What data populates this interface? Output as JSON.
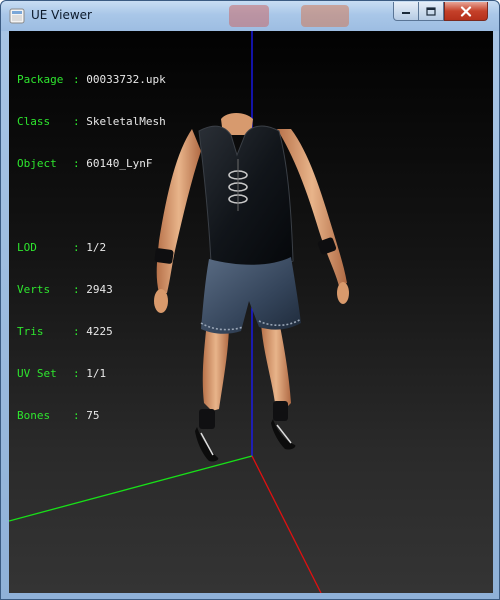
{
  "window": {
    "title": "UE Viewer",
    "app_icon": "ue-viewer-icon",
    "buttons": {
      "minimize_icon": "minimize-icon",
      "maximize_icon": "maximize-icon",
      "close_icon": "close-icon"
    }
  },
  "info": {
    "package": {
      "label": "Package",
      "value": "00033732.upk"
    },
    "class": {
      "label": "Class",
      "value": "SkeletalMesh"
    },
    "object": {
      "label": "Object",
      "value": "60140_LynF"
    },
    "lod": {
      "label": "LOD",
      "value": "1/2"
    },
    "verts": {
      "label": "Verts",
      "value": "2943"
    },
    "tris": {
      "label": "Tris",
      "value": "4225"
    },
    "uvset": {
      "label": "UV Set",
      "value": "1/1"
    },
    "bones": {
      "label": "Bones",
      "value": "75"
    },
    "separator": ":"
  },
  "scene": {
    "axis_colors": {
      "x": "#e01010",
      "y": "#18e018",
      "z": "#1a1aff"
    },
    "label_color": "#2ee62e",
    "value_color": "#e8e8e8"
  }
}
